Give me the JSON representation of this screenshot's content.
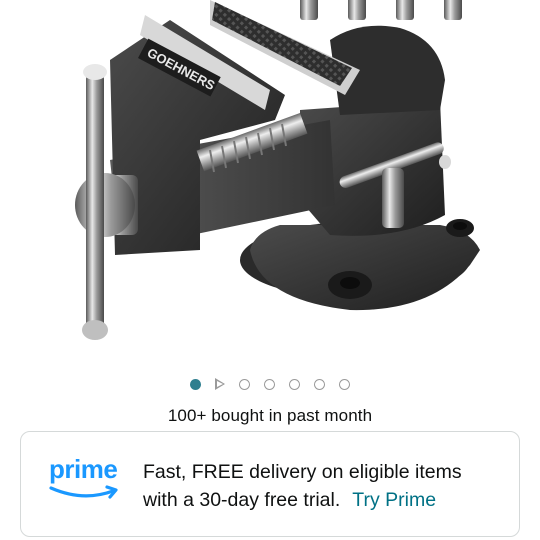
{
  "product": {
    "brand_text": "GOEHNERS"
  },
  "carousel": {
    "active_index": 0,
    "dot_count": 6,
    "has_video_indicator": true
  },
  "social_proof": {
    "bought_text": "100+ bought in past month"
  },
  "prime": {
    "logo_text": "prime",
    "line1": "Fast, FREE delivery on eligible items",
    "line2": "with a 30-day free trial.",
    "cta": "Try Prime",
    "accent_color": "#1a98ff",
    "link_color": "#007185"
  }
}
